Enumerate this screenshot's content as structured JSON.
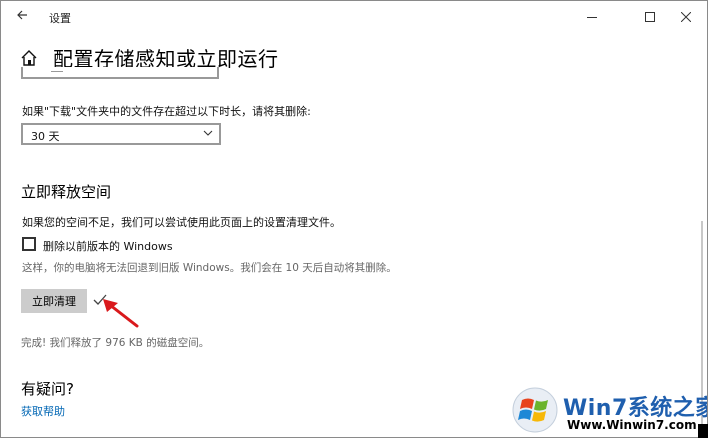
{
  "window": {
    "title": "设置",
    "back_icon": "back-arrow-icon",
    "controls": [
      "minimize-icon",
      "maximize-icon",
      "close-icon"
    ]
  },
  "header": {
    "home_icon": "home-icon",
    "title": "配置存储感知或立即运行"
  },
  "downloads": {
    "label": "如果\"下载\"文件夹中的文件存在超过以下时长，请将其删除:",
    "selected": "30 天"
  },
  "free_space": {
    "title": "立即释放空间",
    "description": "如果您的空间不足，我们可以尝试使用此页面上的设置清理文件。",
    "checkbox_label": "删除以前版本的 Windows",
    "checkbox_checked": false,
    "note": "这样，你的电脑将无法回退到旧版 Windows。我们会在 10 天后自动将其删除。",
    "button_label": "立即清理",
    "result": "完成! 我们释放了 976 KB 的磁盘空间。"
  },
  "help": {
    "title": "有疑问?",
    "link": "获取帮助"
  },
  "watermark": {
    "title": "Win7系统之家",
    "url": "Www.Winwin7.com"
  },
  "colors": {
    "accent_link": "#0066b4",
    "button_bg": "#cccccc",
    "annotation_arrow": "#d9191c"
  }
}
